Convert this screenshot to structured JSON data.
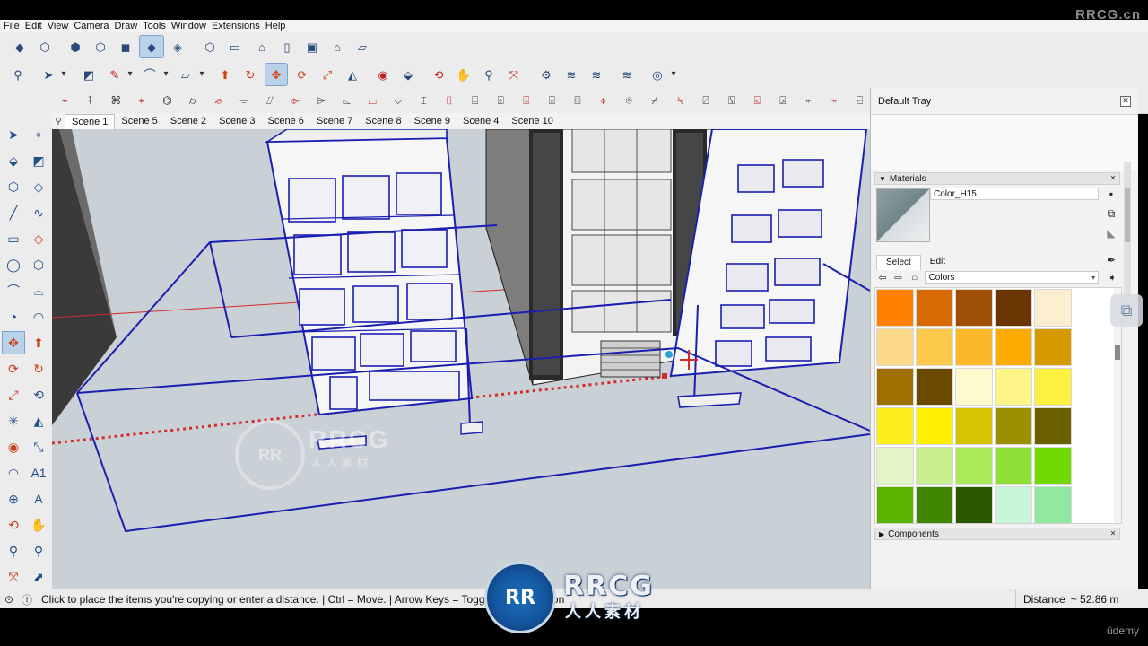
{
  "menu": [
    "File",
    "Edit",
    "View",
    "Camera",
    "Draw",
    "Tools",
    "Window",
    "Extensions",
    "Help"
  ],
  "toolbar_top": [
    "component-icon",
    "group-icon",
    "iso-view-icon",
    "top-view-icon",
    "front-view-icon",
    "right-view-icon",
    "back-view-icon",
    "left-view-icon",
    "xray-icon",
    "wireframe-icon",
    "hidden-line-icon",
    "shaded-icon",
    "shaded-textures-icon",
    "monochrome-icon",
    "house-icon"
  ],
  "scenes": [
    "Scene 1",
    "Scene 5",
    "Scene 2",
    "Scene 3",
    "Scene 6",
    "Scene 7",
    "Scene 8",
    "Scene 9",
    "Scene 4",
    "Scene 10"
  ],
  "active_scene": "Scene 1",
  "tray": {
    "title": "Default Tray",
    "materials": {
      "header": "Materials",
      "current_name": "Color_H15",
      "tabs": [
        "Select",
        "Edit"
      ],
      "active_tab": "Select",
      "library": "Colors",
      "swatches": [
        "#ff8000",
        "#d66b05",
        "#9e4f04",
        "#6b3403",
        "#fbefcf",
        "#fdda8a",
        "#fdc94b",
        "#fcb72a",
        "#fcab00",
        "#d69a00",
        "#9f6f00",
        "#6b4a00",
        "#fefacd",
        "#fdf587",
        "#fdf041",
        "#fdee1c",
        "#fef000",
        "#d6c400",
        "#9c8f00",
        "#6a6000",
        "#e3f4c7",
        "#c7ef8d",
        "#aaea58",
        "#8ee036",
        "#71d900",
        "#5ab400",
        "#3f8500",
        "#2a5900",
        "#c6f6d7",
        "#90e99f"
      ]
    },
    "components": {
      "header": "Components"
    }
  },
  "status": {
    "text": "Click to place the items you're copying or enter a distance. | Ctrl = Move. | Arrow Keys = Toggle Lock Direction",
    "vcb_label": "Distance",
    "vcb_value": "~ 52.86 m"
  },
  "watermarks": {
    "top_right": "RRCG.cn",
    "bottom_right": "ūdemy",
    "logo_text": "RRCG",
    "logo_sub": "人人素材",
    "logo_mark": "RR"
  },
  "colors": {
    "selection_blue": "#1a1fb0",
    "guide_red": "#d42a2a",
    "viewport_bg": "#c9d0d6"
  }
}
